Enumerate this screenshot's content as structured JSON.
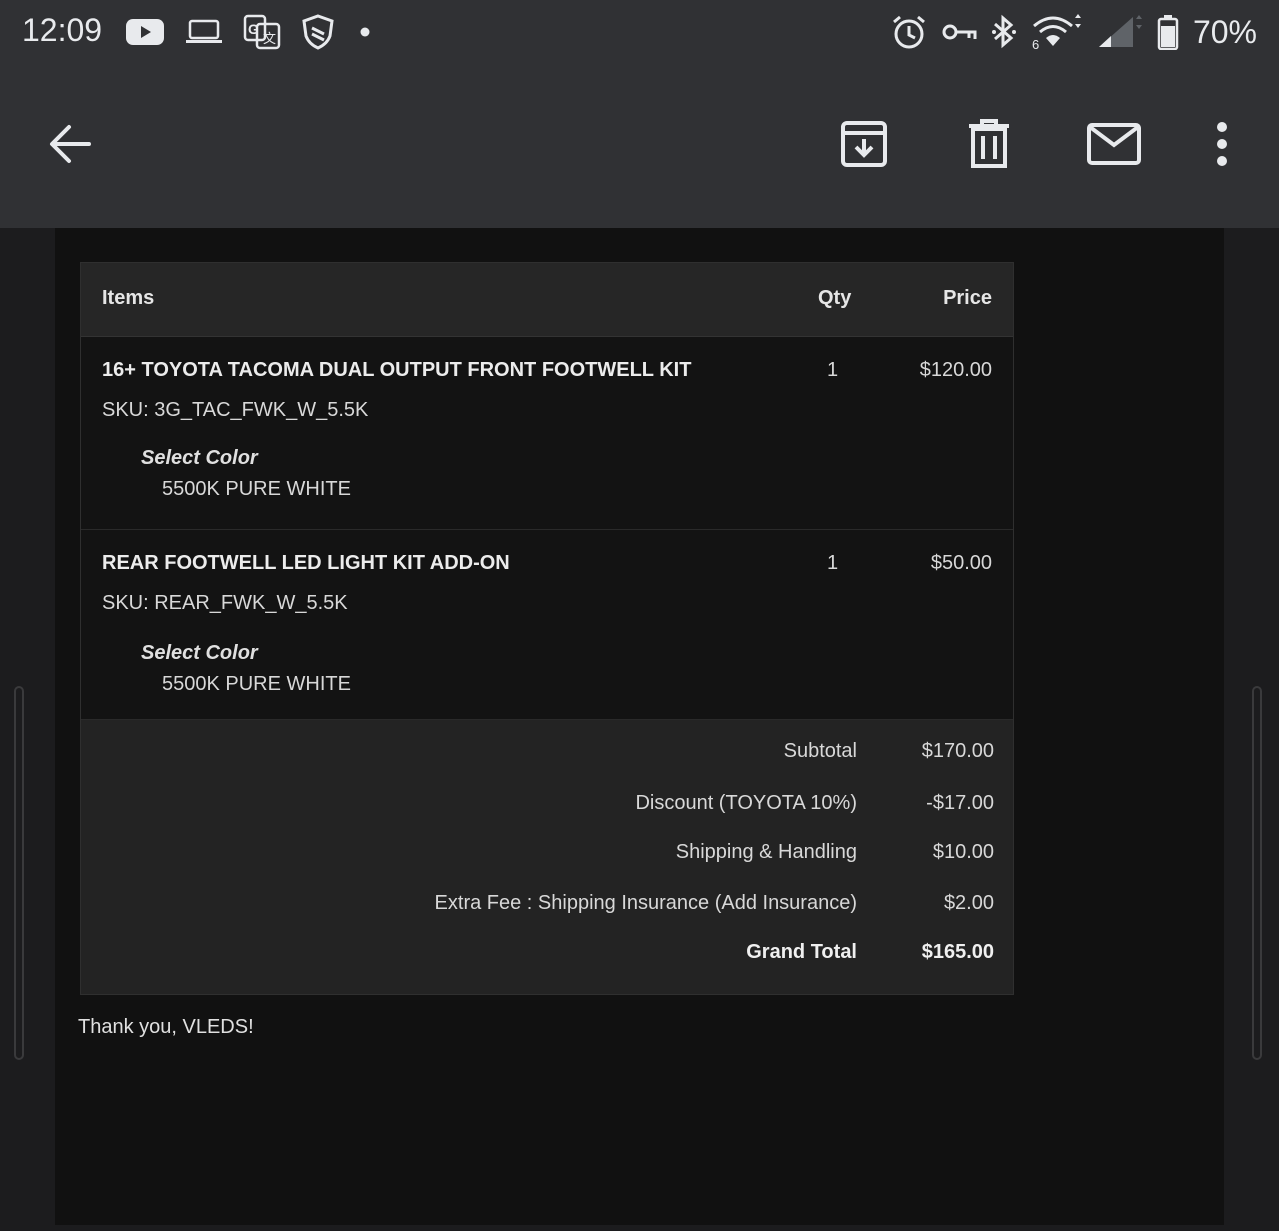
{
  "status_bar": {
    "time": "12:09",
    "battery_percent": "70%",
    "wifi_label": "6",
    "left_icons": [
      "youtube-icon",
      "laptop-icon",
      "translate-icon",
      "shield-icon",
      "notification-dot-icon"
    ],
    "right_icons": [
      "alarm-icon",
      "vpn-key-icon",
      "bluetooth-icon",
      "wifi-icon",
      "cell-signal-icon",
      "battery-icon"
    ]
  },
  "toolbar": {
    "icons": [
      "back-arrow-icon",
      "archive-icon",
      "delete-icon",
      "mark-unread-icon",
      "more-vert-icon"
    ]
  },
  "order": {
    "headers": {
      "items": "Items",
      "qty": "Qty",
      "price": "Price"
    },
    "items": [
      {
        "name": "16+ TOYOTA TACOMA DUAL OUTPUT FRONT FOOTWELL KIT",
        "sku": "SKU: 3G_TAC_FWK_W_5.5K",
        "option_label": "Select Color",
        "option_value": "5500K PURE WHITE",
        "qty": "1",
        "price": "$120.00"
      },
      {
        "name": "REAR FOOTWELL LED LIGHT KIT ADD-ON",
        "sku": "SKU: REAR_FWK_W_5.5K",
        "option_label": "Select Color",
        "option_value": "5500K PURE WHITE",
        "qty": "1",
        "price": "$50.00"
      }
    ],
    "totals": [
      {
        "label": "Subtotal",
        "value": "$170.00"
      },
      {
        "label": "Discount (TOYOTA 10%)",
        "value": "-$17.00"
      },
      {
        "label": "Shipping & Handling",
        "value": "$10.00"
      },
      {
        "label": "Extra Fee : Shipping Insurance (Add Insurance)",
        "value": "$2.00"
      },
      {
        "label": "Grand Total",
        "value": "$165.00"
      }
    ]
  },
  "footer": {
    "thanks": "Thank you, VLEDS!"
  },
  "colors": {
    "bar": "#303134",
    "email_bg": "#111111",
    "header_bg": "#262626",
    "totals_bg": "#232323"
  }
}
